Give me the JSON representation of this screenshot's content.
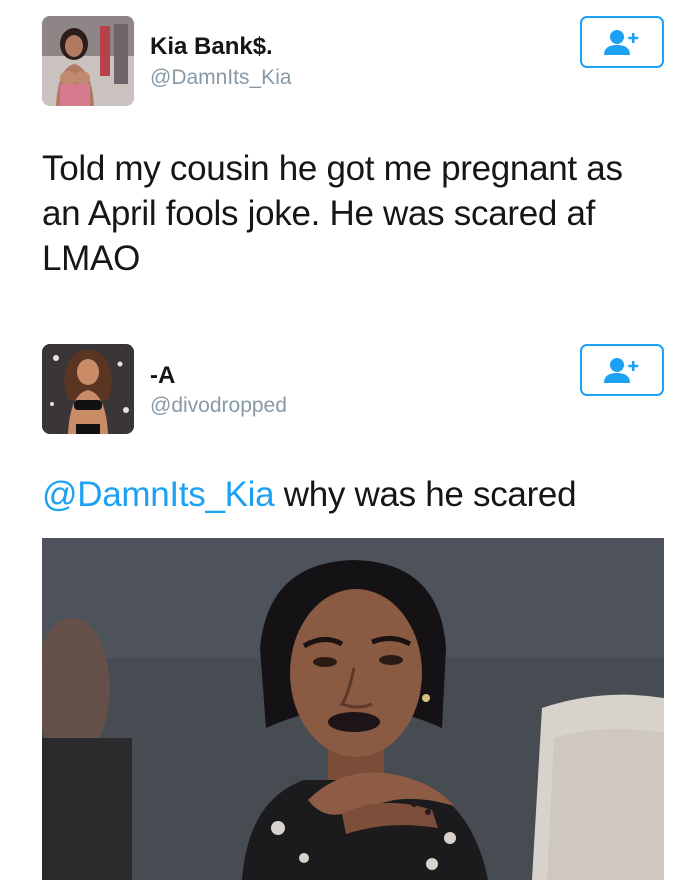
{
  "tweet1": {
    "display_name": "Kia Bank$.",
    "handle": "@DamnIts_Kia",
    "text": "Told my cousin he got me pregnant as an April fools joke. He was scared af LMAO"
  },
  "tweet2": {
    "display_name": "-A",
    "handle": "@divodropped",
    "mention": "@DamnIts_Kia",
    "text": " why was he scared"
  },
  "icons": {
    "follow": "add-user-icon"
  },
  "colors": {
    "accent": "#1da1f2",
    "text": "#14171a",
    "muted": "#8899a6"
  }
}
